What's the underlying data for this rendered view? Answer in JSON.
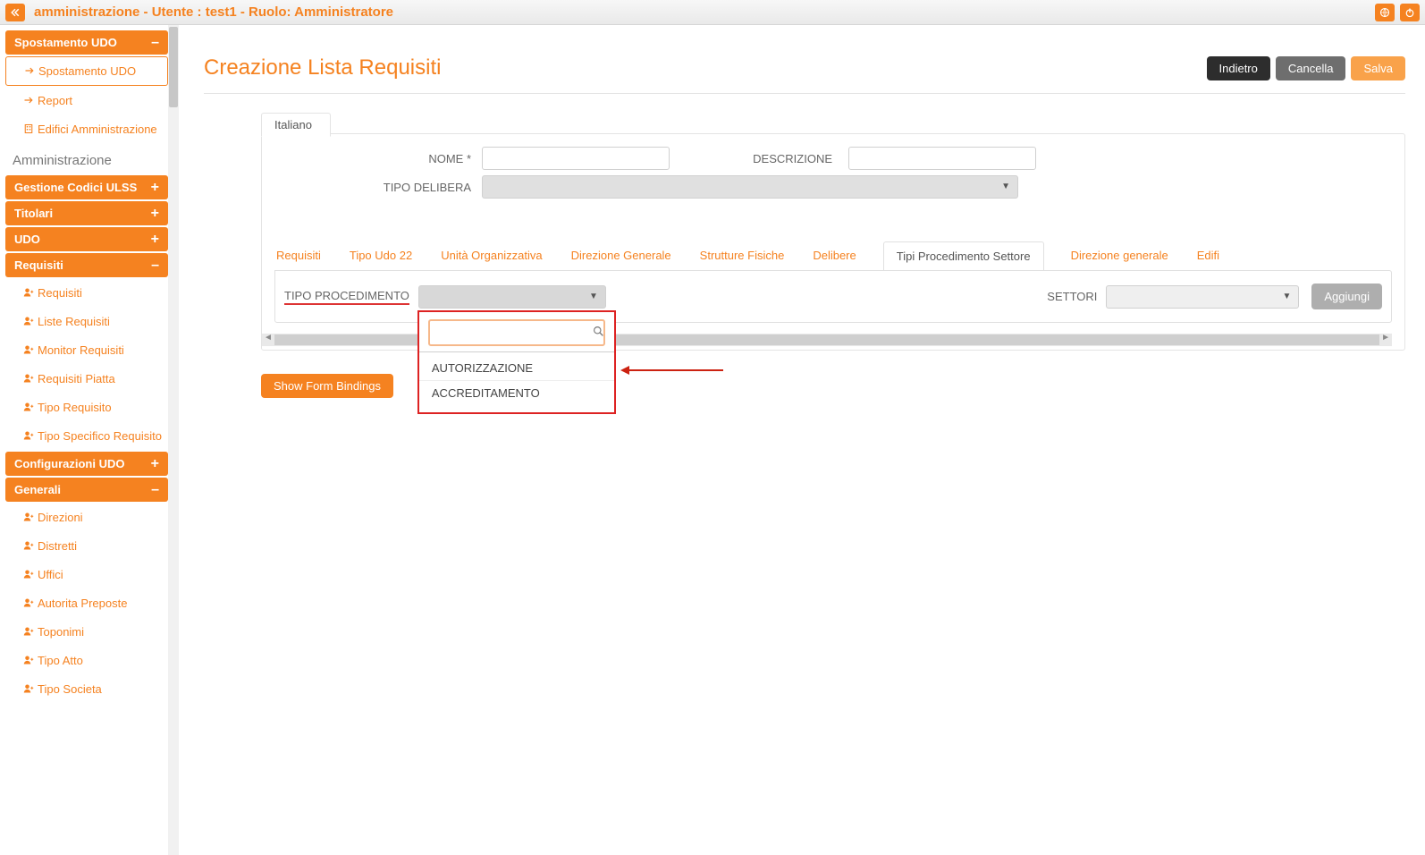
{
  "header": {
    "title": "amministrazione - Utente : test1 - Ruolo: Amministratore"
  },
  "sidebar": {
    "sections": [
      {
        "kind": "hdr",
        "label": "Spostamento UDO",
        "pm": "–"
      },
      {
        "kind": "item",
        "label": "Spostamento UDO",
        "icon": "arrow",
        "active": true
      },
      {
        "kind": "item",
        "label": "Report",
        "icon": "arrow"
      },
      {
        "kind": "item",
        "label": "Edifici Amministrazione",
        "icon": "building"
      },
      {
        "kind": "label",
        "label": "Amministrazione"
      },
      {
        "kind": "hdr",
        "label": "Gestione Codici ULSS",
        "pm": "+"
      },
      {
        "kind": "hdr",
        "label": "Titolari",
        "pm": "+"
      },
      {
        "kind": "hdr",
        "label": "UDO",
        "pm": "+"
      },
      {
        "kind": "hdr",
        "label": "Requisiti",
        "pm": "–"
      },
      {
        "kind": "item",
        "label": "Requisiti",
        "icon": "user"
      },
      {
        "kind": "item",
        "label": "Liste Requisiti",
        "icon": "user"
      },
      {
        "kind": "item",
        "label": "Monitor Requisiti",
        "icon": "user"
      },
      {
        "kind": "item",
        "label": "Requisiti Piatta",
        "icon": "user"
      },
      {
        "kind": "item",
        "label": "Tipo Requisito",
        "icon": "user"
      },
      {
        "kind": "item",
        "label": "Tipo Specifico Requisito",
        "icon": "user"
      },
      {
        "kind": "hdr",
        "label": "Configurazioni UDO",
        "pm": "+"
      },
      {
        "kind": "hdr",
        "label": "Generali",
        "pm": "–"
      },
      {
        "kind": "item",
        "label": "Direzioni",
        "icon": "user"
      },
      {
        "kind": "item",
        "label": "Distretti",
        "icon": "user"
      },
      {
        "kind": "item",
        "label": "Uffici",
        "icon": "user"
      },
      {
        "kind": "item",
        "label": "Autorita Preposte",
        "icon": "user"
      },
      {
        "kind": "item",
        "label": "Toponimi",
        "icon": "user"
      },
      {
        "kind": "item",
        "label": "Tipo Atto",
        "icon": "user"
      },
      {
        "kind": "item",
        "label": "Tipo Societa",
        "icon": "user"
      }
    ]
  },
  "page": {
    "title": "Creazione Lista Requisiti",
    "buttons": {
      "back": "Indietro",
      "cancel": "Cancella",
      "save": "Salva"
    },
    "lang_tab": "Italiano",
    "fields": {
      "nome": "NOME *",
      "descrizione": "DESCRIZIONE",
      "tipo_delibera": "TIPO DELIBERA"
    },
    "tabs": [
      "Requisiti",
      "Tipo Udo 22",
      "Unità Organizzativa",
      "Direzione Generale",
      "Strutture Fisiche",
      "Delibere",
      "Tipi Procedimento Settore",
      "Direzione generale",
      "Edifi"
    ],
    "active_tab_index": 6,
    "tabpane": {
      "tipo_procedimento": "TIPO PROCEDIMENTO",
      "settori": "SETTORI",
      "aggiungi": "Aggiungi"
    },
    "dropdown": {
      "search_placeholder": "",
      "options": [
        "AUTORIZZAZIONE",
        "ACCREDITAMENTO"
      ]
    },
    "show_bindings": "Show Form Bindings"
  }
}
